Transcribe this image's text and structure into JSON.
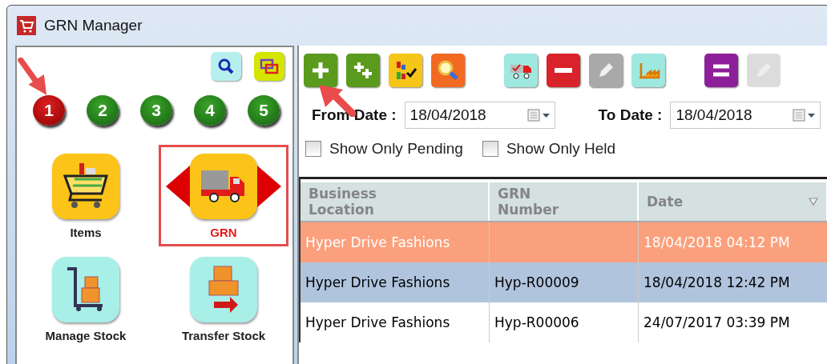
{
  "window": {
    "title": "GRN Manager"
  },
  "sidebar": {
    "pages": [
      {
        "label": "1",
        "selected": true
      },
      {
        "label": "2",
        "selected": false
      },
      {
        "label": "3",
        "selected": false
      },
      {
        "label": "4",
        "selected": false
      },
      {
        "label": "5",
        "selected": false
      }
    ],
    "modules": [
      {
        "label": "Items",
        "kind": "cart",
        "selected": false
      },
      {
        "label": "GRN",
        "kind": "truck",
        "selected": true
      },
      {
        "label": "Manage Stock",
        "kind": "trolley",
        "selected": false
      },
      {
        "label": "Transfer Stock",
        "kind": "transfer",
        "selected": false
      }
    ]
  },
  "toolbar": {
    "groups": [
      [
        {
          "kind": "add",
          "disabled": false
        },
        {
          "kind": "add-multi",
          "disabled": false
        },
        {
          "kind": "chart-check",
          "disabled": false
        },
        {
          "kind": "find",
          "disabled": false
        }
      ],
      [
        {
          "kind": "truck-check",
          "disabled": false
        },
        {
          "kind": "remove",
          "disabled": false
        },
        {
          "kind": "edit",
          "disabled": false
        },
        {
          "kind": "factory",
          "disabled": false
        }
      ],
      [
        {
          "kind": "equals",
          "disabled": false
        },
        {
          "kind": "edit",
          "disabled": true
        }
      ]
    ]
  },
  "filters": {
    "from_label": "From Date :",
    "from_value": "18/04/2018",
    "to_label": "To Date :",
    "to_value": "18/04/2018",
    "checks": [
      {
        "label": "Show Only Pending",
        "checked": false
      },
      {
        "label": "Show Only Held",
        "checked": false
      }
    ]
  },
  "table": {
    "columns": [
      {
        "label": "Business Location"
      },
      {
        "label": "GRN Number"
      },
      {
        "label": "Date",
        "sorted": true
      }
    ],
    "rows": [
      {
        "cells": [
          "Hyper Drive Fashions",
          "",
          "18/04/2018 04:12 PM"
        ],
        "highlighted": true,
        "selected": false
      },
      {
        "cells": [
          "Hyper Drive Fashions",
          "Hyp-R00009",
          "18/04/2018 12:42 PM"
        ],
        "highlighted": false,
        "selected": true
      },
      {
        "cells": [
          "Hyper Drive Fashions",
          "Hyp-R00006",
          "24/07/2017 03:39 PM"
        ],
        "highlighted": false,
        "selected": false
      }
    ]
  }
}
